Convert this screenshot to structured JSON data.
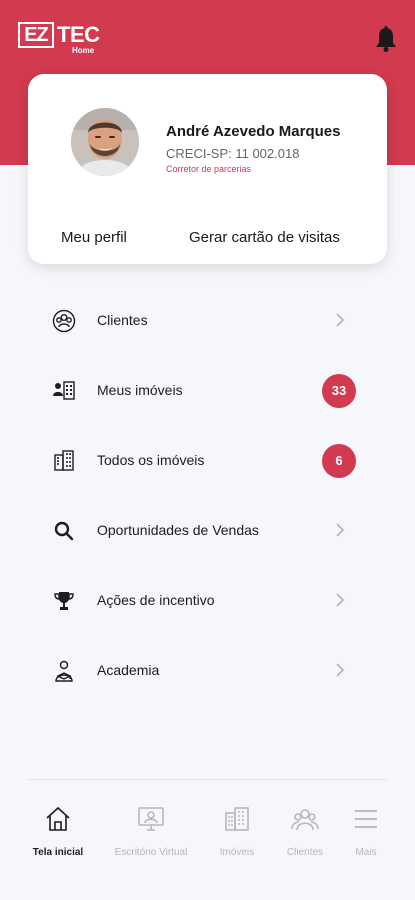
{
  "header": {
    "logo_ez": "EZ",
    "logo_tec": "TEC",
    "logo_home": "Home",
    "notification_icon": "bell-icon"
  },
  "profile": {
    "name": "André Azevedo Marques",
    "creci": "CRECI-SP: 11 002.018",
    "role": "Corretor de parcerias",
    "link_profile": "Meu perfil",
    "link_card": "Gerar cartão de visitas"
  },
  "menu": {
    "items": [
      {
        "label": "Clientes",
        "icon": "clients-icon",
        "badge": null
      },
      {
        "label": "Meus imóveis",
        "icon": "my-properties-icon",
        "badge": "33"
      },
      {
        "label": "Todos os imóveis",
        "icon": "buildings-icon",
        "badge": "6"
      },
      {
        "label": "Oportunidades de Vendas",
        "icon": "search-icon",
        "badge": null
      },
      {
        "label": "Ações de incentivo",
        "icon": "trophy-icon",
        "badge": null
      },
      {
        "label": "Academia",
        "icon": "academy-icon",
        "badge": null
      }
    ]
  },
  "nav": {
    "items": [
      {
        "label": "Tela inicial",
        "icon": "home-icon",
        "active": true
      },
      {
        "label": "Escritório Virtual",
        "icon": "virtual-office-icon",
        "active": false
      },
      {
        "label": "Imóveis",
        "icon": "buildings-icon",
        "active": false
      },
      {
        "label": "Clientes",
        "icon": "clients-icon",
        "active": false
      },
      {
        "label": "Mais",
        "icon": "menu-icon",
        "active": false
      }
    ]
  },
  "colors": {
    "brand": "#d13a4f",
    "background": "#f6f7fb",
    "inactive_nav": "#b5b7bd"
  }
}
